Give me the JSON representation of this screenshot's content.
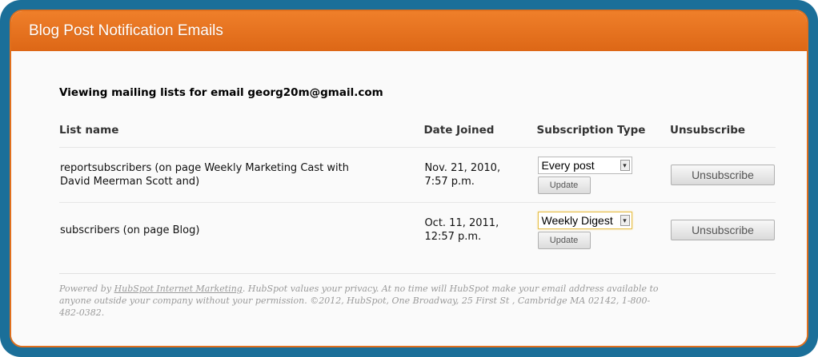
{
  "panel": {
    "title": "Blog Post Notification Emails"
  },
  "viewing": {
    "label": "Viewing mailing lists for email georg20m@gmail.com"
  },
  "table": {
    "headers": {
      "list_name": "List name",
      "date_joined": "Date Joined",
      "subscription_type": "Subscription Type",
      "unsubscribe": "Unsubscribe"
    },
    "rows": [
      {
        "list_name_line1": "reportsubscribers (on page Weekly Marketing Cast with",
        "list_name_line2": "David Meerman Scott and)",
        "date_line1": "Nov. 21, 2010,",
        "date_line2": "7:57 p.m.",
        "subscription_value": "Every post",
        "update_label": "Update",
        "unsubscribe_label": "Unsubscribe"
      },
      {
        "list_name_line1": "subscribers (on page Blog)",
        "list_name_line2": "",
        "date_line1": "Oct. 11, 2011,",
        "date_line2": "12:57 p.m.",
        "subscription_value": "Weekly Digest",
        "update_label": "Update",
        "unsubscribe_label": "Unsubscribe"
      }
    ]
  },
  "footer": {
    "prefix": "Powered by ",
    "link_text": "HubSpot Internet Marketing",
    "line1_rest": ". HubSpot values your privacy. At no time will HubSpot make your email address available to",
    "line2": "anyone outside your company without your permission. ©2012, HubSpot, One Broadway, 25 First St , Cambridge MA 02142, 1-800-",
    "line3": "482-0382."
  },
  "icons": {
    "select_arrow": "chevron-down-icon"
  },
  "colors": {
    "frame": "#1b6f99",
    "header": "#e36f1a",
    "panel_background": "#fafafa"
  }
}
